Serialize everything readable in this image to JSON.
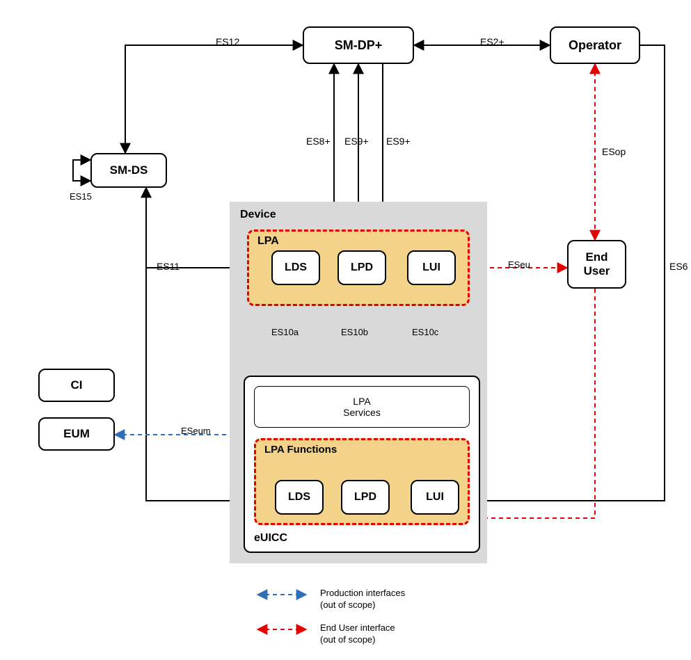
{
  "diagram": {
    "nodes": {
      "sm_dp": "SM-DP+",
      "operator": "Operator",
      "sm_ds": "SM-DS",
      "end_user": "End\nUser",
      "ci": "CI",
      "eum": "EUM",
      "lds1": "LDS",
      "lpd1": "LPD",
      "lui1": "LUI",
      "lpa_services": "LPA\nServices",
      "lds2": "LDS",
      "lpd2": "LPD",
      "lui2": "LUI"
    },
    "groups": {
      "device": "Device",
      "lpa": "LPA",
      "lpa_functions": "LPA Functions",
      "euicc": "eUICC"
    },
    "edges": {
      "es12": "ES12",
      "es2p": "ES2+",
      "es8p": "ES8+",
      "es9p_a": "ES9+",
      "es9p_b": "ES9+",
      "esop": "ESop",
      "es15": "ES15",
      "es11": "ES11",
      "eseu": "ESeu",
      "es10a": "ES10a",
      "es10b": "ES10b",
      "es10c": "ES10c",
      "eseum": "ESeum",
      "es6": "ES6"
    },
    "legend": {
      "production": "Production interfaces\n(out of scope)",
      "end_user": "End User interface\n(out of scope)"
    }
  }
}
